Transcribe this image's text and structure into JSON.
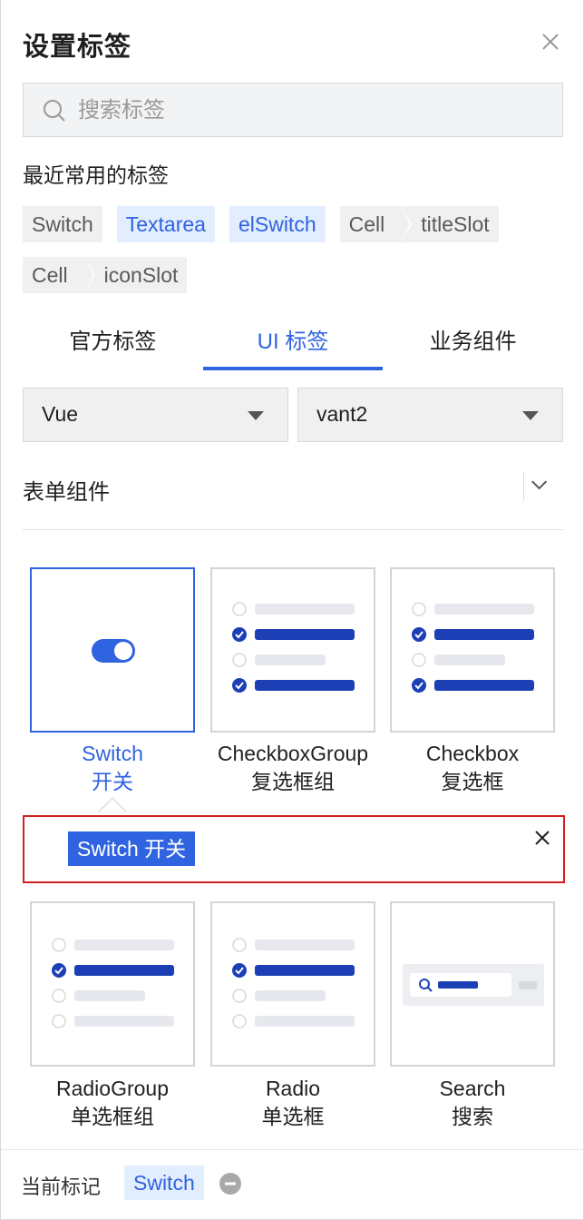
{
  "header": {
    "title": "设置标签"
  },
  "search": {
    "placeholder": "搜索标签",
    "value": ""
  },
  "recent": {
    "title": "最近常用的标签",
    "row1": [
      "Switch",
      "Textarea",
      "elSwitch"
    ],
    "combo1": {
      "parent": "Cell",
      "child": "titleSlot"
    },
    "combo2": {
      "parent": "Cell",
      "child": "iconSlot"
    }
  },
  "tabs": [
    {
      "label": "官方标签",
      "active": false
    },
    {
      "label": "UI 标签",
      "active": true
    },
    {
      "label": "业务组件",
      "active": false
    }
  ],
  "filters": {
    "framework": "Vue",
    "library": "vant2"
  },
  "section": {
    "title": "表单组件"
  },
  "components": [
    {
      "name": "Switch",
      "cn": "开关",
      "selected": true,
      "icon": "switch-toggle-icon"
    },
    {
      "name": "CheckboxGroup",
      "cn": "复选框组",
      "selected": false,
      "icon": "checkbox-group-icon"
    },
    {
      "name": "Checkbox",
      "cn": "复选框",
      "selected": false,
      "icon": "checkbox-icon"
    },
    {
      "name": "RadioGroup",
      "cn": "单选框组",
      "selected": false,
      "icon": "radio-group-icon"
    },
    {
      "name": "Radio",
      "cn": "单选框",
      "selected": false,
      "icon": "radio-icon"
    },
    {
      "name": "Search",
      "cn": "搜索",
      "selected": false,
      "icon": "search-bar-icon"
    }
  ],
  "detail": {
    "chip": "Switch 开关"
  },
  "footer": {
    "label": "当前标记",
    "tag": "Switch"
  },
  "colors": {
    "accent": "#2f63e0",
    "highlight_bg": "#e2edfd",
    "alert_border": "#d22020"
  }
}
